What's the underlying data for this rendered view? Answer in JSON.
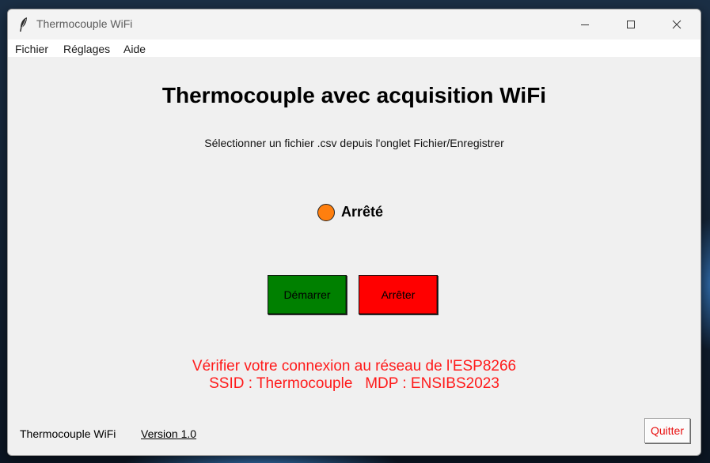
{
  "window": {
    "title": "Thermocouple WiFi",
    "icon": "feather-icon",
    "controls": [
      "minimize-icon",
      "maximize-icon",
      "close-icon"
    ]
  },
  "menu": {
    "items": [
      "Fichier",
      "Réglages",
      "Aide"
    ]
  },
  "main": {
    "heading": "Thermocouple avec acquisition WiFi",
    "instruction": "Sélectionner un fichier .csv depuis l'onglet Fichier/Enregistrer",
    "status": {
      "label": "Arrêté",
      "indicator_color": "#ff7f0e"
    },
    "buttons": {
      "start_label": "Démarrer",
      "start_color": "#008000",
      "stop_label": "Arrêter",
      "stop_color": "#ff0000"
    },
    "warning": {
      "line1": "Vérifier votre connexion au réseau de l'ESP8266",
      "line2": "SSID : Thermocouple   MDP : ENSIBS2023",
      "color": "#ff1a1a"
    }
  },
  "footer": {
    "app_name": "Thermocouple WiFi",
    "version": "Version 1.0",
    "quit_label": "Quitter"
  }
}
